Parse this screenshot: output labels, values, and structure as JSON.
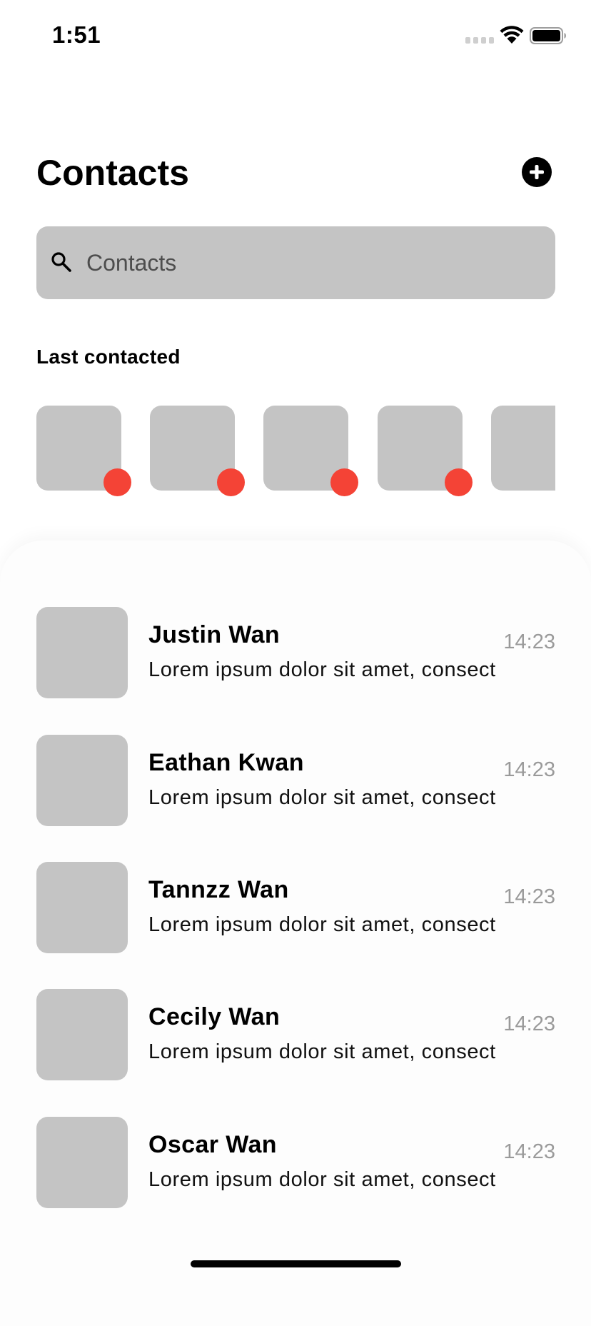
{
  "status_bar": {
    "time": "1:51"
  },
  "header": {
    "title": "Contacts",
    "add_icon": "plus-circle-icon"
  },
  "search": {
    "placeholder": "Contacts",
    "value": "",
    "icon": "search-icon"
  },
  "last_contacted": {
    "heading": "Last contacted",
    "badge_color": "#f44336",
    "items": [
      {
        "avatar": "placeholder"
      },
      {
        "avatar": "placeholder"
      },
      {
        "avatar": "placeholder"
      },
      {
        "avatar": "placeholder"
      },
      {
        "avatar": "placeholder"
      }
    ]
  },
  "contacts": [
    {
      "name": "Justin Wan",
      "message": "Lorem ipsum dolor sit amet, consect",
      "time": "14:23"
    },
    {
      "name": "Eathan Kwan",
      "message": "Lorem ipsum dolor sit amet, consect",
      "time": "14:23"
    },
    {
      "name": "Tannzz Wan",
      "message": "Lorem ipsum dolor sit amet, consect",
      "time": "14:23"
    },
    {
      "name": "Cecily Wan",
      "message": "Lorem ipsum dolor sit amet, consect",
      "time": "14:23"
    },
    {
      "name": "Oscar Wan",
      "message": "Lorem ipsum dolor sit amet, consect",
      "time": "14:23"
    }
  ],
  "colors": {
    "placeholder_gray": "#c4c4c4",
    "badge_red": "#f44336",
    "time_gray": "#9a9a9a"
  }
}
